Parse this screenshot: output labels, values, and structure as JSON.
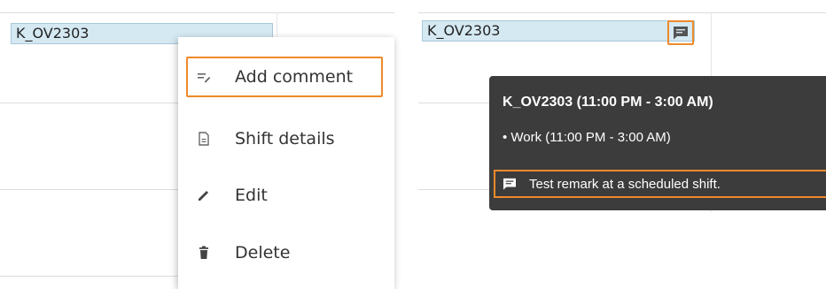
{
  "left": {
    "shift_label": "K_OV2303",
    "menu": {
      "add_comment": "Add comment",
      "shift_details": "Shift details",
      "edit": "Edit",
      "delete": "Delete"
    }
  },
  "right": {
    "shift_label": "K_OV2303",
    "tooltip": {
      "title": "K_OV2303 (11:00 PM - 3:00 AM)",
      "activity": "• Work (11:00 PM - 3:00 AM)",
      "remark": "Test remark at a scheduled shift."
    }
  },
  "colors": {
    "highlight": "#ee8a2a",
    "shift_fill": "#d5e9f3",
    "tooltip_bg": "#3c3c3c"
  },
  "icons": {
    "add_comment": "add-comment-icon",
    "shift_details": "document-icon",
    "edit": "pencil-icon",
    "delete": "trash-icon",
    "comment": "comment-icon"
  }
}
